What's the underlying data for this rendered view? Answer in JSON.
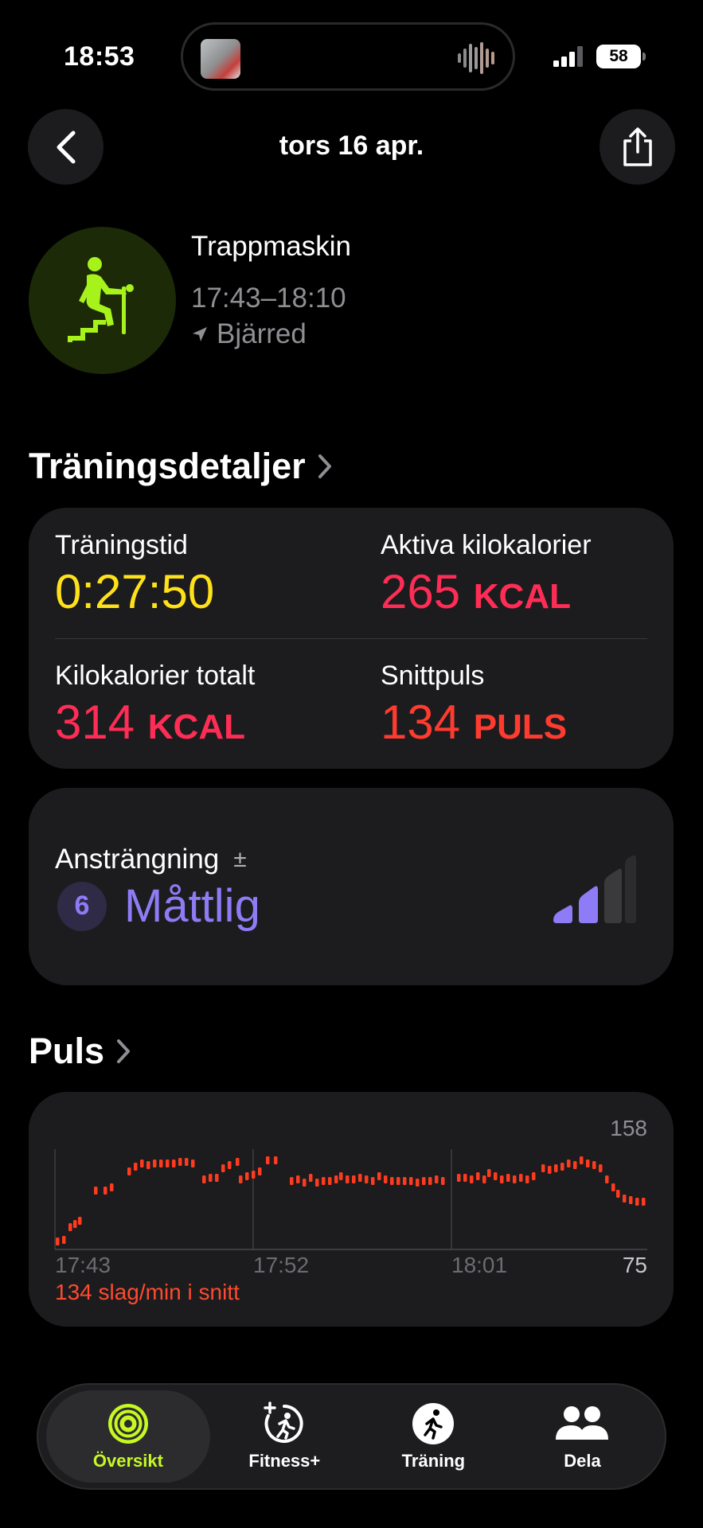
{
  "status_bar": {
    "time": "18:53",
    "battery": "58"
  },
  "nav": {
    "title": "tors 16 apr."
  },
  "workout": {
    "name": "Trappmaskin",
    "time_range": "17:43–18:10",
    "location": "Bjärred",
    "accent_color": "#a6f21a"
  },
  "details": {
    "heading": "Träningsdetaljer",
    "metrics": [
      {
        "label": "Träningstid",
        "value": "0:27:50",
        "unit": "",
        "color": "#ffe11a"
      },
      {
        "label": "Aktiva kilokalorier",
        "value": "265",
        "unit": "KCAL",
        "color": "#ff2d55"
      },
      {
        "label": "Kilokalorier totalt",
        "value": "314",
        "unit": "KCAL",
        "color": "#ff2d55"
      },
      {
        "label": "Snittpuls",
        "value": "134",
        "unit": "PULS",
        "color": "#ff3b30"
      }
    ]
  },
  "effort": {
    "label": "Ansträngning",
    "adjust_icon": "±",
    "score": "6",
    "level_text": "Måttlig",
    "level_bars_filled": 2,
    "level_bars_total": 4,
    "color": "#8e7cf6"
  },
  "heart_rate": {
    "heading": "Puls",
    "max_label": "158",
    "min_label": "75",
    "average_text": "134 slag/min i snitt",
    "time_ticks": [
      "17:43",
      "17:52",
      "18:01"
    ],
    "color": "#ff3b1f"
  },
  "tabbar": {
    "tabs": [
      {
        "label": "Översikt",
        "icon": "activity-rings-icon",
        "active": true
      },
      {
        "label": "Fitness+",
        "icon": "fitness-plus-icon",
        "active": false
      },
      {
        "label": "Träning",
        "icon": "running-figure-icon",
        "active": false
      },
      {
        "label": "Dela",
        "icon": "people-icon",
        "active": false
      }
    ]
  }
}
